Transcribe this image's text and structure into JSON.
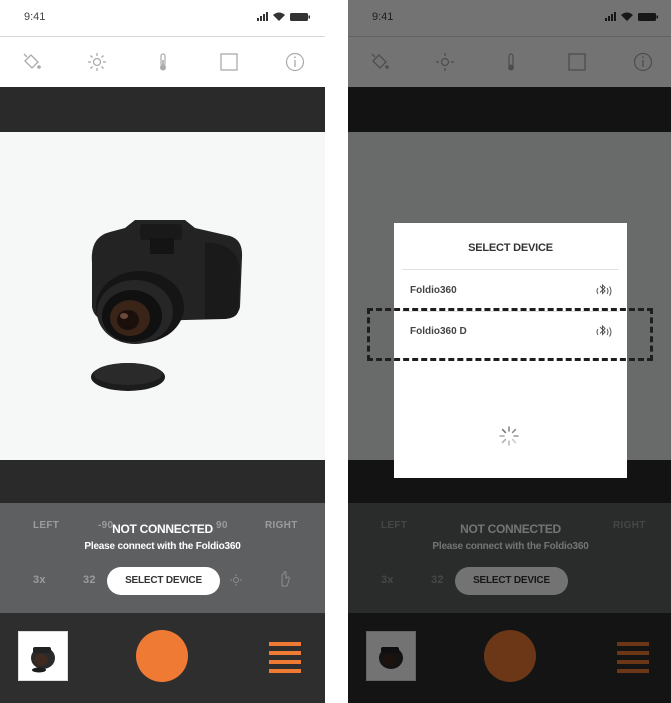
{
  "status_bar": {
    "time": "9:41"
  },
  "toolbar": {
    "icons": [
      "bucket-icon",
      "sun-icon",
      "thermometer-icon",
      "square-icon",
      "info-icon"
    ]
  },
  "controls": {
    "left_label": "LEFT",
    "right_label": "RIGHT",
    "angle_left": "-90",
    "angle_right": "90",
    "speed": "3x",
    "frames": "32",
    "select_device_button": "SELECT DEVICE"
  },
  "connection": {
    "title": "NOT CONNECTED",
    "subtitle": "Please connect with the Foldio360"
  },
  "modal": {
    "title": "SELECT DEVICE",
    "devices": [
      {
        "name": "Foldio360"
      },
      {
        "name": "Foldio360 D"
      }
    ]
  },
  "colors": {
    "accent": "#ef7a33",
    "dark": "#2a2a2a",
    "panel": "#5d5f61"
  }
}
